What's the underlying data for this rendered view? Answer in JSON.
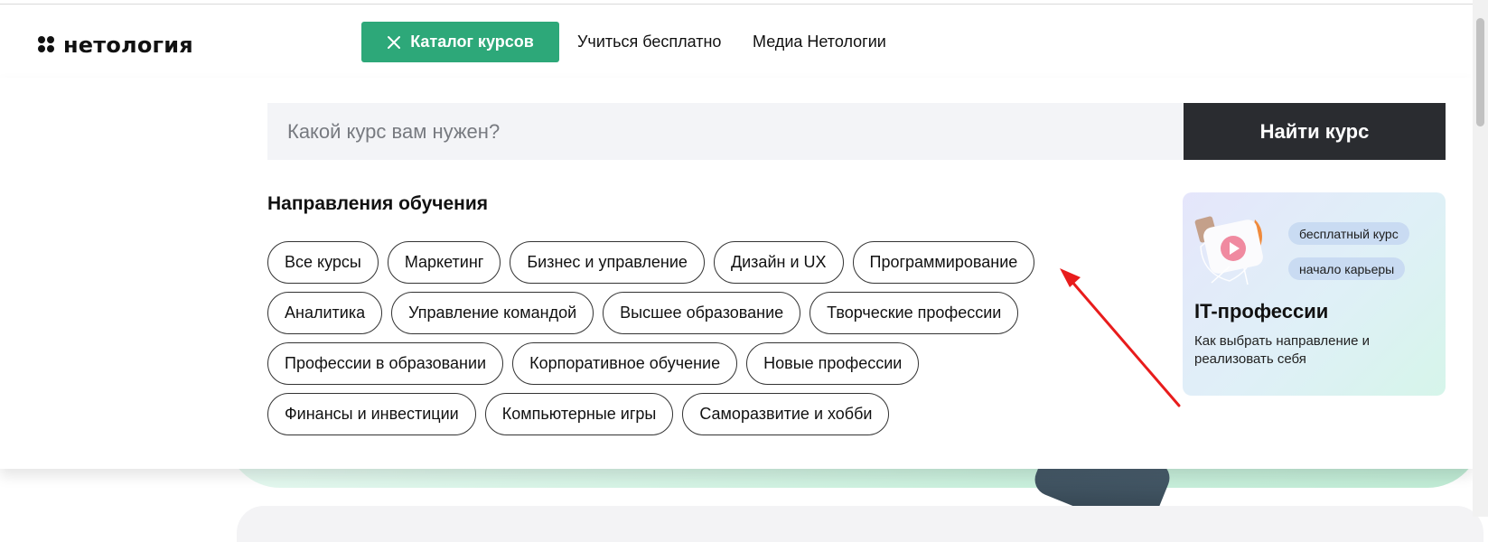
{
  "header": {
    "logo_text": "нетология",
    "catalog_button_label": "Каталог курсов",
    "nav_links": [
      "Учиться бесплатно",
      "Медиа Нетологии"
    ]
  },
  "search": {
    "placeholder": "Какой курс вам нужен?",
    "button_label": "Найти курс"
  },
  "directions": {
    "title": "Направления обучения",
    "rows": [
      [
        "Все курсы",
        "Маркетинг",
        "Бизнес и управление",
        "Дизайн и UX",
        "Программирование"
      ],
      [
        "Аналитика",
        "Управление командой",
        "Высшее образование",
        "Творческие профессии"
      ],
      [
        "Профессии в образовании",
        "Корпоративное обучение",
        "Новые профессии"
      ],
      [
        "Финансы и инвестиции",
        "Компьютерные игры",
        "Саморазвитие и хобби"
      ]
    ]
  },
  "promo": {
    "badges": [
      "бесплатный курс",
      "начало карьеры"
    ],
    "title": "IT-профессии",
    "description": "Как выбрать направление и реализовать себя"
  },
  "colors": {
    "accent_green": "#2da879",
    "search_button_bg": "#2a2c30",
    "annotation_red": "#e81c1c"
  }
}
